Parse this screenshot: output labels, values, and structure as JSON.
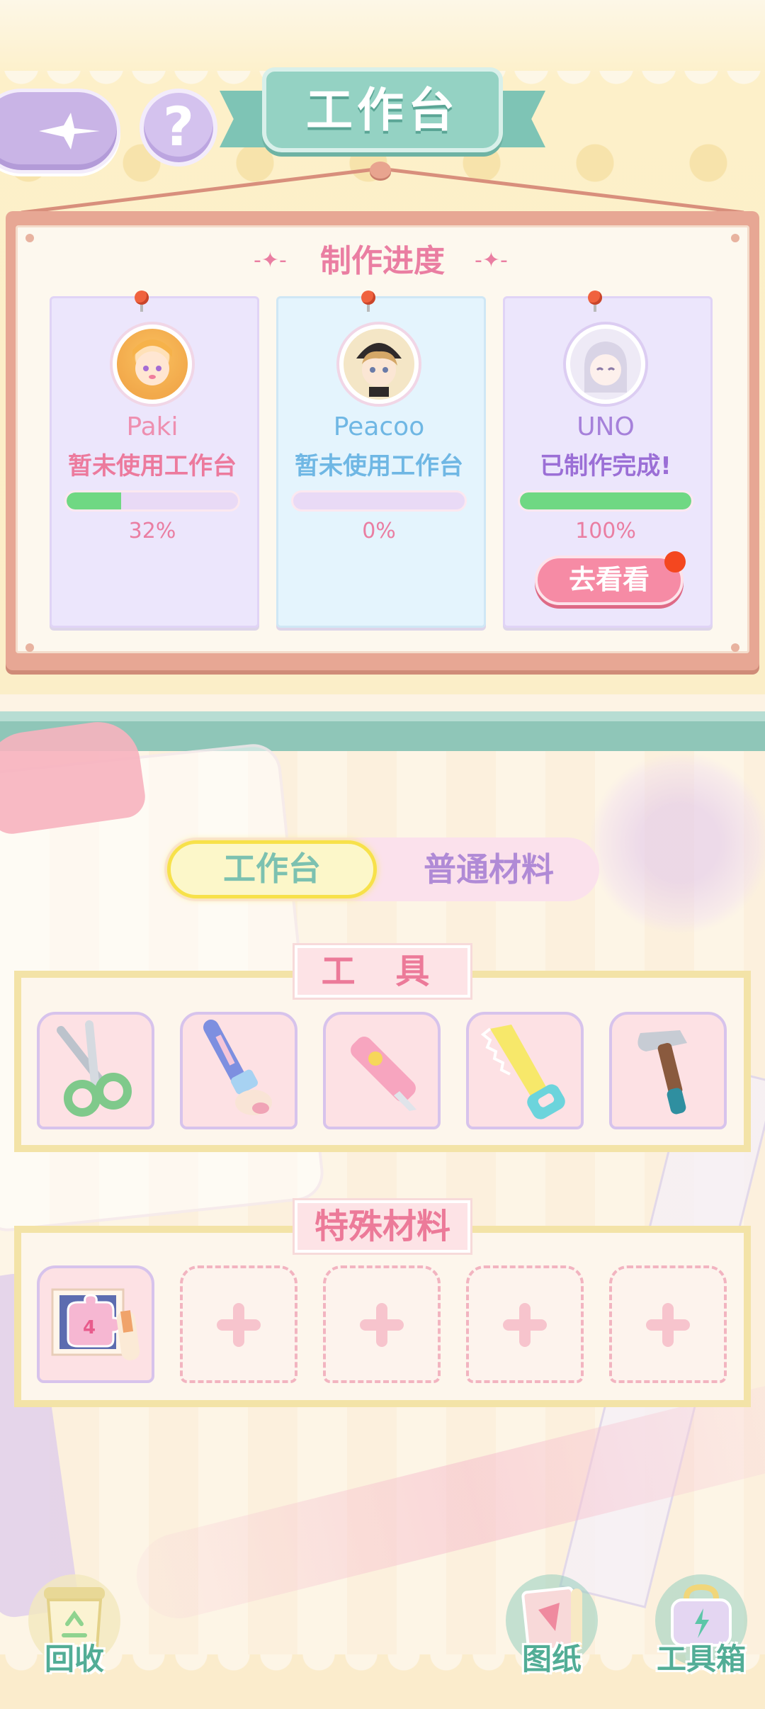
{
  "header": {
    "title": "工作台",
    "back_icon": "star-back-icon",
    "help_label": "?"
  },
  "progress_board": {
    "title": "制作进度",
    "cards": [
      {
        "name": "Paki",
        "status": "暂未使用工作台",
        "progress": 0.32,
        "percent_label": "32%",
        "name_color": "#ee8fb0",
        "status_color": "#ec7a9d"
      },
      {
        "name": "Peacoo",
        "status": "暂未使用工作台",
        "progress": 0.0,
        "percent_label": "0%",
        "name_color": "#6fb7e4",
        "status_color": "#6fb7e4"
      },
      {
        "name": "UNO",
        "status": "已制作完成!",
        "progress": 1.0,
        "percent_label": "100%",
        "name_color": "#a681da",
        "status_color": "#9b6fd6",
        "action_label": "去看看"
      }
    ]
  },
  "tabs": {
    "active": "工作台",
    "inactive": "普通材料"
  },
  "tools": {
    "label": "工 具",
    "items": [
      "scissors-icon",
      "paintbrush-icon",
      "utility-knife-icon",
      "saw-icon",
      "hammer-icon"
    ]
  },
  "special_materials": {
    "label": "特殊材料",
    "filled_item": {
      "icon": "puzzle-blueprint-icon",
      "badge": "4"
    },
    "empty_slots": 4
  },
  "bottom_bar": {
    "recycle": "回收",
    "blueprint": "图纸",
    "toolbox": "工具箱"
  },
  "colors": {
    "accent_pink": "#ea7ea2",
    "teal": "#94d2c3",
    "progress_green": "#6fd883"
  }
}
